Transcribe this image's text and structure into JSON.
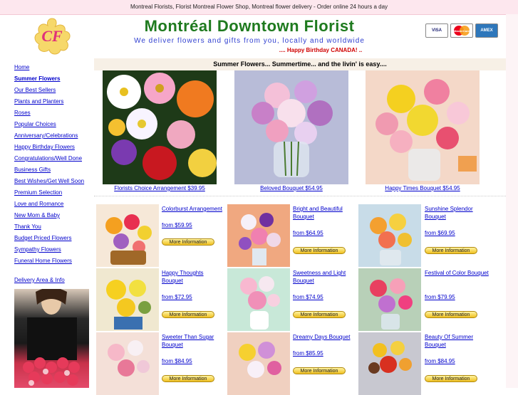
{
  "topbar": {
    "text": "Montreal Florists, Florist Montreal Flower Shop, Montreal flower delivery  -  Order online 24 hours a day"
  },
  "header": {
    "logo_letters": "CF",
    "title": "Montréal Downtown Florist",
    "tagline": "We deliver flowers and gifts from you, locally and worldwide",
    "birthday": ".... Happy Birthday CANADA! ..",
    "cards": [
      "VISA",
      "MasterCard",
      "AMEX"
    ]
  },
  "sidebar": {
    "items": [
      {
        "label": "Home"
      },
      {
        "label": "Summer Flowers"
      },
      {
        "label": "Our Best Sellers"
      },
      {
        "label": "Plants and Planters"
      },
      {
        "label": "Roses"
      },
      {
        "label": "Popular Choices"
      },
      {
        "label": "Anniversary/Celebrations"
      },
      {
        "label": "Happy Birthday Flowers"
      },
      {
        "label": "Congratulations/Well Done"
      },
      {
        "label": "Business Gifts"
      },
      {
        "label": "Best Wishes/Get Well Soon"
      },
      {
        "label": "Premium Selection"
      },
      {
        "label": "Love and Romance"
      },
      {
        "label": "New Mom & Baby"
      },
      {
        "label": "Thank You"
      },
      {
        "label": "Budget Priced Flowers"
      },
      {
        "label": "Sympathy Flowers"
      },
      {
        "label": "Funeral Home Flowers"
      }
    ],
    "delivery": "Delivery Area & Info"
  },
  "main": {
    "heading": "Summer Flowers... Summertime... and the livin' is easy....",
    "featured": [
      {
        "caption": "Florists Choice Arrangement $39.95"
      },
      {
        "caption": "Beloved Bouquet $54.95"
      },
      {
        "caption": "Happy Times Bouquet $54.95"
      }
    ],
    "more_label": "More Information",
    "items": [
      {
        "name": "Colorburst Arrangement",
        "price": "from $59.95"
      },
      {
        "name": "Bright and Beautiful Bouquet",
        "price": "from $64.95"
      },
      {
        "name": "Sunshine Splendor Bouquet",
        "price": "from $69.95"
      },
      {
        "name": "Happy Thoughts Bouquet",
        "price": "from $72.95"
      },
      {
        "name": "Sweetness and Light Bouquet",
        "price": "from $74.95"
      },
      {
        "name": "Festival of Color Bouquet",
        "price": "from $79.95"
      },
      {
        "name": "Sweeter Than Sugar Bouquet",
        "price": "from $84.95"
      },
      {
        "name": "Dreamy Days Bouquet",
        "price": "from $85.95"
      },
      {
        "name": "Beauty Of Summer Bouquet",
        "price": "from $84.95"
      }
    ]
  }
}
